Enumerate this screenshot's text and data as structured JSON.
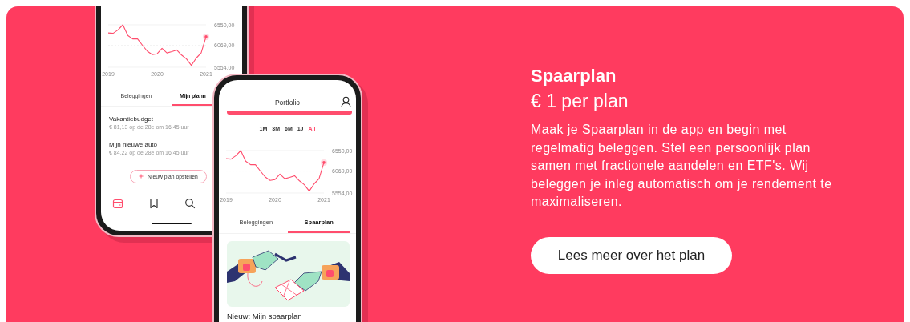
{
  "phones": [
    {
      "kind": "plans",
      "chart_data": {
        "type": "line",
        "x": [
          2019,
          2019.1,
          2019.2,
          2019.3,
          2019.4,
          2019.5,
          2019.6,
          2019.7,
          2019.8,
          2019.9,
          2020,
          2020.1,
          2020.2,
          2020.3,
          2020.4,
          2020.5,
          2020.6,
          2020.7,
          2020.8,
          2020.9,
          2021
        ],
        "series": [
          {
            "color": "#ff4d6d",
            "values": [
              6360,
              6350,
              6430,
              6550,
              6300,
              6220,
              6220,
              6070,
              5930,
              5850,
              5870,
              6000,
              5890,
              5920,
              5960,
              5840,
              5750,
              5600,
              5770,
              5890,
              6270
            ]
          }
        ],
        "xlim": [
          2019,
          2021
        ],
        "ylim": [
          5554,
          6550
        ],
        "xticks": [
          {
            "value": 2019,
            "label": "2019"
          },
          {
            "value": 2020,
            "label": "2020"
          },
          {
            "value": 2021,
            "label": "2021"
          }
        ],
        "yticks": [
          {
            "value": 6550,
            "label": "6550,00"
          },
          {
            "value": 6069,
            "label": "6069,00"
          },
          {
            "value": 5554,
            "label": "5554,00"
          }
        ]
      },
      "tabs": [
        {
          "label": "Beleggingen",
          "selected": false
        },
        {
          "label": "Mijn plann",
          "selected": true
        }
      ],
      "plans": [
        {
          "name": "Vakantiebudget",
          "detail": "€ 81,13 op de 28e om 16:45 uur"
        },
        {
          "name": "Mijn nieuwe auto",
          "detail": "€ 84,22 op de 28e om 16:45 uur"
        }
      ],
      "new_plan_button": "Nieuw plan opstellen",
      "nav": [
        {
          "kind": "wallet",
          "selected": true
        },
        {
          "kind": "bookmark",
          "selected": false
        },
        {
          "kind": "search",
          "selected": false
        }
      ]
    },
    {
      "kind": "portfolio",
      "title": "Portfolio",
      "ranges": [
        {
          "label": "1M",
          "selected": false
        },
        {
          "label": "3M",
          "selected": false
        },
        {
          "label": "6M",
          "selected": false
        },
        {
          "label": "1J",
          "selected": false
        },
        {
          "label": "All",
          "selected": true
        }
      ],
      "chart_data": {
        "type": "line",
        "x": [
          2019,
          2019.1,
          2019.2,
          2019.3,
          2019.4,
          2019.5,
          2019.6,
          2019.7,
          2019.8,
          2019.9,
          2020,
          2020.1,
          2020.2,
          2020.3,
          2020.4,
          2020.5,
          2020.6,
          2020.7,
          2020.8,
          2020.9,
          2021
        ],
        "series": [
          {
            "color": "#ff4d6d",
            "values": [
              6360,
              6350,
              6430,
              6550,
              6300,
              6220,
              6220,
              6070,
              5930,
              5850,
              5870,
              6000,
              5890,
              5920,
              5960,
              5840,
              5750,
              5600,
              5770,
              5890,
              6270
            ]
          }
        ],
        "xlim": [
          2019,
          2021
        ],
        "ylim": [
          5554,
          6550
        ],
        "xticks": [
          {
            "value": 2019,
            "label": "2019"
          },
          {
            "value": 2020,
            "label": "2020"
          },
          {
            "value": 2021,
            "label": "2021"
          }
        ],
        "yticks": [
          {
            "value": 6550,
            "label": "6550,00"
          },
          {
            "value": 6069,
            "label": "6069,00"
          },
          {
            "value": 5554,
            "label": "5554,00"
          }
        ]
      },
      "tabs": [
        {
          "label": "Beleggingen",
          "selected": false
        },
        {
          "label": "Spaarplan",
          "selected": true
        }
      ],
      "feature_title": "Nieuw: Mijn spaarplan"
    }
  ],
  "promo": {
    "title": "Spaarplan",
    "price": "€ 1 per plan",
    "body": "Maak je Spaarplan in de app en begin met regelmatig beleggen. Stel een persoonlijk plan samen met fractionele aandelen en ETF's. Wij beleggen je inleg automatisch om je rendement te maximaliseren.",
    "button": "Lees meer over het plan"
  }
}
